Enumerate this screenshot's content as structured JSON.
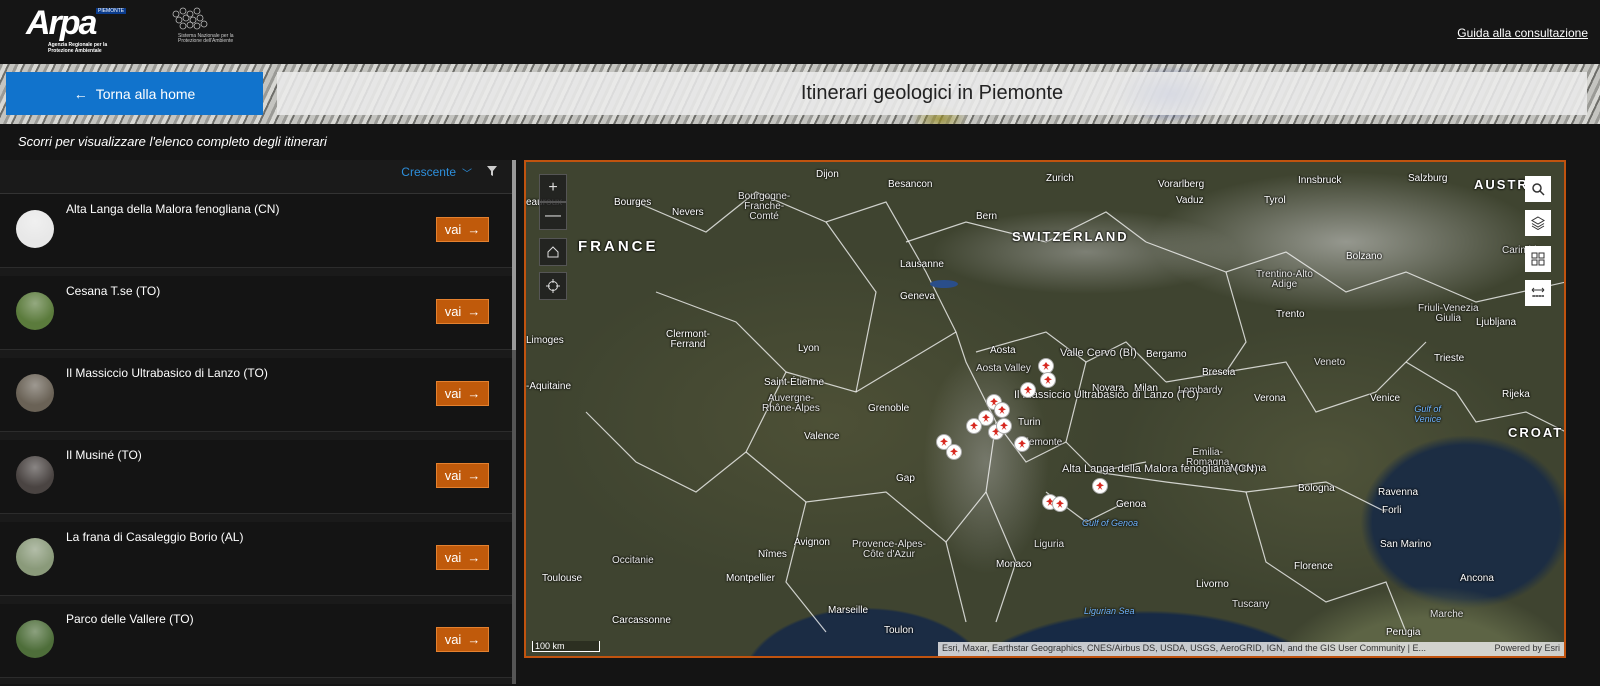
{
  "header": {
    "logo_word": "Arpa",
    "logo_region": "PIEMONTE",
    "logo_tagline": "Agenzia Regionale per la Protezione Ambientale",
    "partner_caption": "Sistema Nazionale per la Protezione dell'Ambiente",
    "guide_link": "Guida alla consultazione"
  },
  "banner": {
    "home_button": "Torna alla home",
    "title": "Itinerari geologici in Piemonte"
  },
  "hint": "Scorri per visualizzare l'elenco completo degli itinerari",
  "list": {
    "sort_label": "Crescente",
    "go_label": "vai",
    "items": [
      {
        "name": "Alta Langa della Malora fenogliana (CN)",
        "thumb": "#e8e8e8"
      },
      {
        "name": "Cesana T.se (TO)",
        "thumb": "#5b7b3c"
      },
      {
        "name": "Il Massiccio Ultrabasico di Lanzo (TO)",
        "thumb": "#6a6256"
      },
      {
        "name": "Il Musiné (TO)",
        "thumb": "#4a4442"
      },
      {
        "name": "La frana di Casaleggio Borio (AL)",
        "thumb": "#8a9a7a"
      },
      {
        "name": "Parco delle Vallere (TO)",
        "thumb": "#4e6e3a"
      }
    ]
  },
  "map": {
    "labels": {
      "france": "FRANCE",
      "switzerland": "SWITZERLAND",
      "austria": "AUSTR",
      "croatia": "CROAT",
      "dijon": "Dijon",
      "besancon": "Besancon",
      "zurich": "Zurich",
      "vorarlberg": "Vorarlberg",
      "innsbruck": "Innsbruck",
      "salzburg": "Salzburg",
      "bourges": "Bourges",
      "nevers": "Nevers",
      "eauroux": "eauroux",
      "bourgogne": "Bourgogne-\nFranche-\nComté",
      "vaduz": "Vaduz",
      "tyrol": "Tyrol",
      "bern": "Bern",
      "carinthia": "Carinthia",
      "trento_alto": "Trentino-Alto\nAdige",
      "lausanne": "Lausanne",
      "geneva": "Geneva",
      "bolzano": "Bolzano",
      "trento": "Trento",
      "friuli": "Friuli-Venezia\nGiulia",
      "ljubljana": "Ljubljana",
      "limoges": "Limoges",
      "clermont": "Clermont-\nFerrand",
      "lyon": "Lyon",
      "aosta": "Aosta",
      "aosta_valley": "Aosta Valley",
      "valle_cervo": "Valle Cervo (BI)",
      "bergamo": "Bergamo",
      "brescia": "Brescia",
      "veneto": "Veneto",
      "trieste": "Trieste",
      "aquitaine": "-Aquitaine",
      "saint_etienne": "Saint-Étienne",
      "auvergne": "Auvergne-\nRhône-Alpes",
      "novara": "Novara",
      "milan": "Milan",
      "lombardy": "Lombardy",
      "verona": "Verona",
      "venice": "Venice",
      "gulf_venice": "Gulf of\nVenice",
      "rijeka": "Rijeka",
      "massiccio": "Il Massiccio Ultrabasico di Lanzo (TO)",
      "grenoble": "Grenoble",
      "turin": "Turin",
      "valence": "Valence",
      "piemonte": "Piemonte",
      "emilia": "Emilia-\nRomagna",
      "modena": "Modena",
      "alta_langa": "Alta Langa della Malora fenogliana (CN)",
      "gap": "Gap",
      "genoa": "Genoa",
      "bologna": "Bologna",
      "ravenna": "Ravenna",
      "gulf_genoa": "Gulf of Genoa",
      "forli": "Forli",
      "avignon": "Avignon",
      "provence": "Provence-Alpes-\nCôte d'Azur",
      "liguria": "Liguria",
      "san_marino": "San Marino",
      "occitanie": "Occitanie",
      "nimes": "Nîmes",
      "toulouse": "Toulouse",
      "montpellier": "Montpellier",
      "monaco": "Monaco",
      "florence": "Florence",
      "ancona": "Ancona",
      "livorno": "Livorno",
      "ligurian_sea": "Ligurian Sea",
      "tuscany": "Tuscany",
      "marseille": "Marseille",
      "carcassonne": "Carcassonne",
      "marche": "Marche",
      "toulon": "Toulon",
      "perugia": "Perugia"
    },
    "scale": "100 km",
    "attribution": "Esri, Maxar, Earthstar Geographics, CNES/Airbus DS, USDA, USGS, AeroGRID, IGN, and the GIS User Community | E...",
    "powered": "Powered by Esri"
  }
}
